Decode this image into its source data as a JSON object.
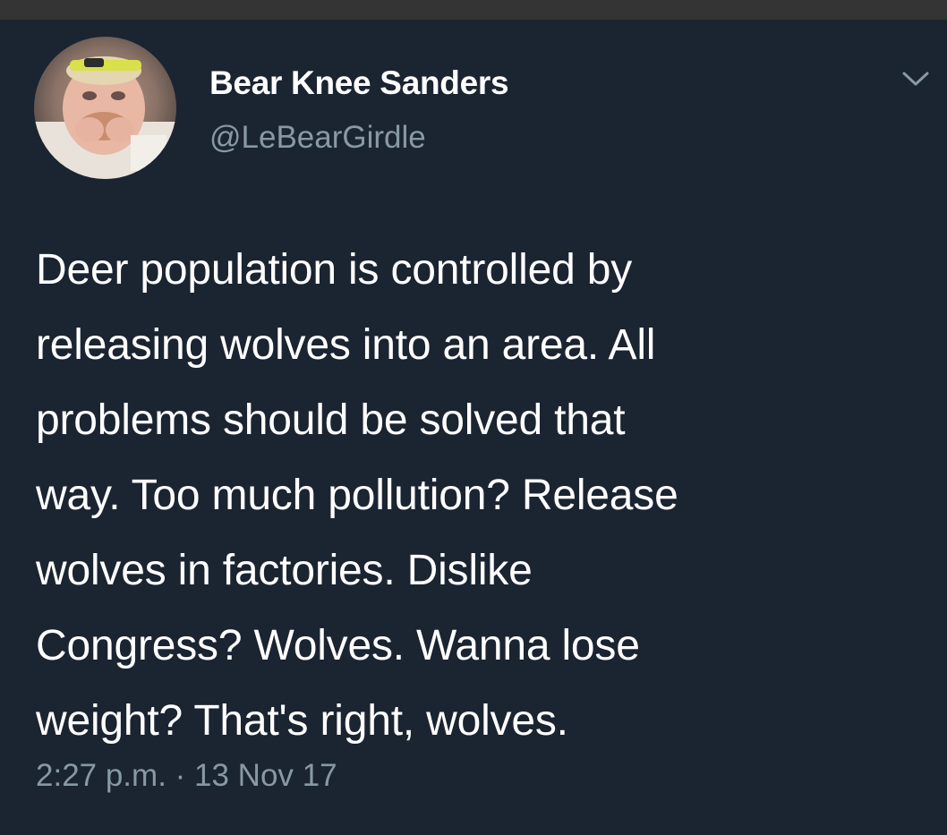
{
  "tweet": {
    "author": {
      "display_name": "Bear Knee Sanders",
      "handle": "@LeBearGirdle",
      "avatar_icon": "profile-photo"
    },
    "menu_icon": "chevron-down-icon",
    "text_lines": [
      "Deer population is controlled by",
      "releasing wolves into an area. All",
      "problems should be solved that",
      "way. Too much pollution? Release",
      "wolves in factories. Dislike",
      "Congress? Wolves. Wanna lose",
      "weight? That's right, wolves."
    ],
    "time": "2:27 p.m.",
    "separator": " · ",
    "date": "13 Nov 17"
  },
  "colors": {
    "background": "#1b2431",
    "status_bar": "#343434",
    "primary_text": "#ffffff",
    "secondary_text": "#8899a6"
  }
}
